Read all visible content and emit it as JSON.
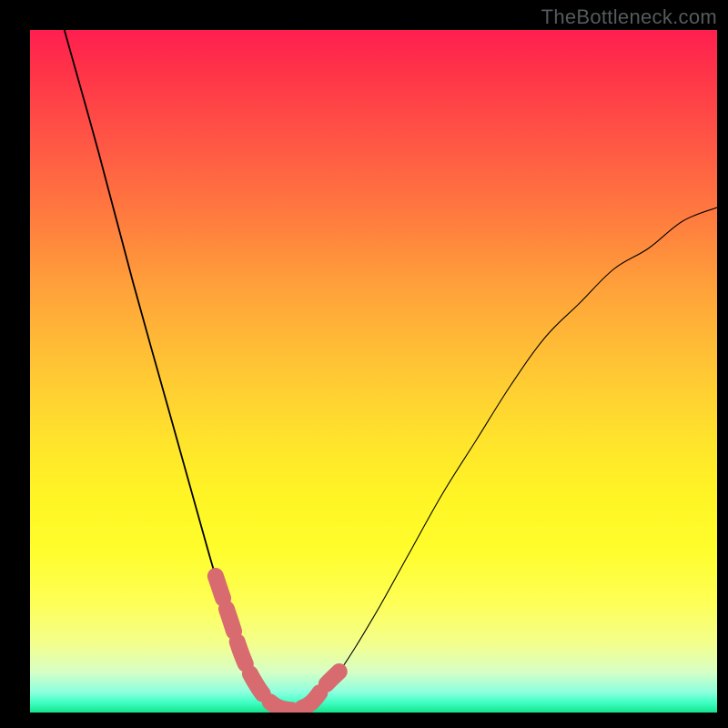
{
  "watermark": "TheBottleneck.com",
  "colors": {
    "page_bg": "#000000",
    "gradient_top": "#ff1f50",
    "gradient_bottom": "#14e58f",
    "curve_thin": "#000000",
    "curve_thick": "#d86b6f"
  },
  "chart_data": {
    "type": "line",
    "title": "",
    "xlabel": "",
    "ylabel": "",
    "xlim": [
      0,
      100
    ],
    "ylim": [
      0,
      100
    ],
    "series": [
      {
        "name": "bottleneck-curve",
        "x": [
          5,
          10,
          15,
          20,
          25,
          27,
          29,
          31,
          33,
          35,
          37,
          39,
          41,
          45,
          50,
          55,
          60,
          65,
          70,
          75,
          80,
          85,
          90,
          95,
          100
        ],
        "y": [
          100,
          82,
          63,
          45,
          27,
          20,
          14,
          8,
          4,
          1.5,
          0.5,
          0.5,
          1.5,
          6,
          14,
          23,
          32,
          40,
          48,
          55,
          60,
          65,
          68,
          72,
          74
        ]
      }
    ],
    "highlight": {
      "name": "optimal-zone",
      "x": [
        27,
        29,
        31,
        33,
        35,
        37,
        39,
        41,
        43,
        45
      ],
      "y": [
        20,
        14,
        8,
        4,
        1.5,
        0.5,
        0.5,
        1.5,
        4,
        6
      ]
    }
  }
}
